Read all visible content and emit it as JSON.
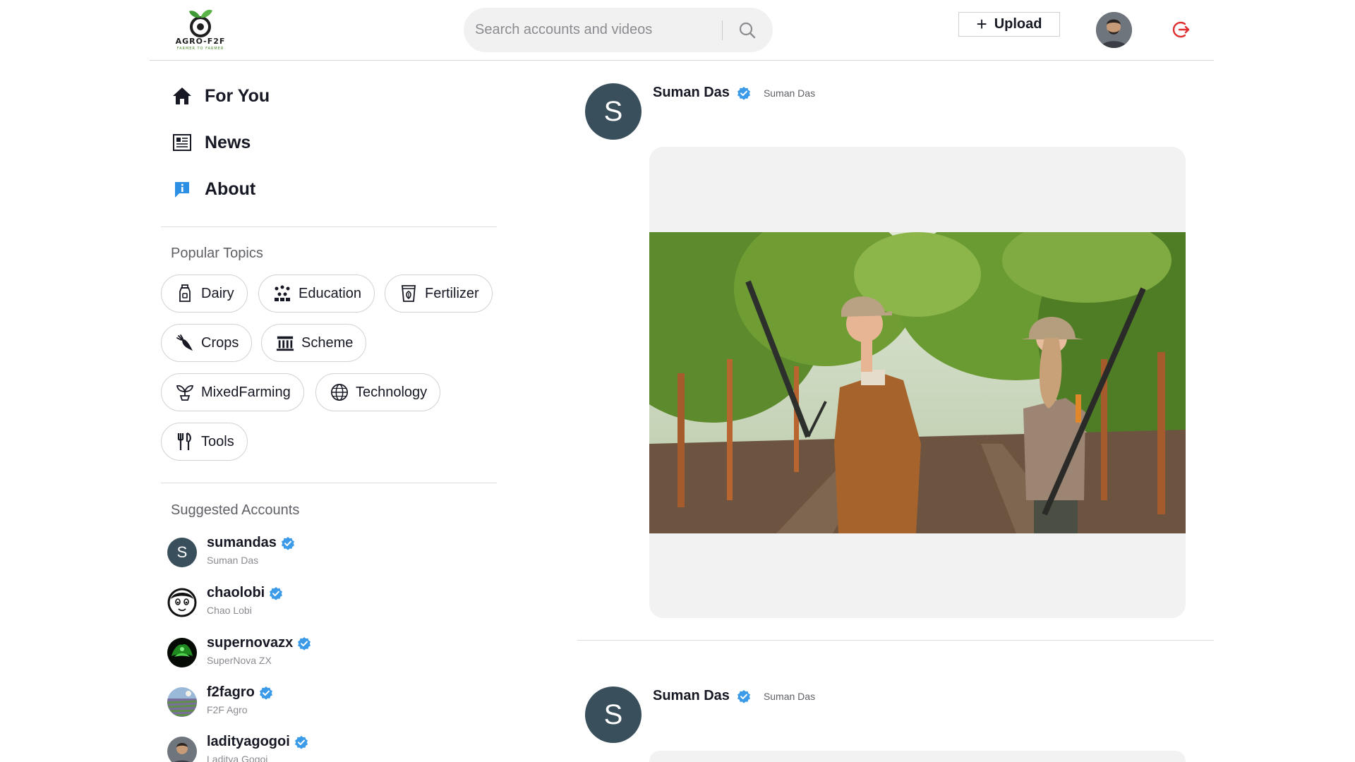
{
  "header": {
    "logo_title": "AGRO-F2F",
    "logo_subtitle": "FARMER TO FARMER",
    "search_placeholder": "Search accounts and videos",
    "upload_label": "Upload",
    "accent_color": "#e02d2d"
  },
  "nav": [
    {
      "label": "For You",
      "icon": "home-icon"
    },
    {
      "label": "News",
      "icon": "newspaper-icon"
    },
    {
      "label": "About",
      "icon": "info-icon"
    }
  ],
  "topics": {
    "title": "Popular Topics",
    "items": [
      {
        "label": "Dairy",
        "icon": "milk-bottle-icon"
      },
      {
        "label": "Education",
        "icon": "people-group-icon"
      },
      {
        "label": "Fertilizer",
        "icon": "fertilizer-icon"
      },
      {
        "label": "Crops",
        "icon": "carrot-icon"
      },
      {
        "label": "Scheme",
        "icon": "building-icon"
      },
      {
        "label": "MixedFarming",
        "icon": "sprout-icon"
      },
      {
        "label": "Technology",
        "icon": "globe-icon"
      },
      {
        "label": "Tools",
        "icon": "tools-icon"
      }
    ]
  },
  "suggested": {
    "title": "Suggested Accounts",
    "accounts": [
      {
        "username": "sumandas",
        "display": "Suman Das",
        "avatar": "S"
      },
      {
        "username": "chaolobi",
        "display": "Chao Lobi",
        "avatar": ""
      },
      {
        "username": "supernovazx",
        "display": "SuperNova ZX",
        "avatar": ""
      },
      {
        "username": "f2fagro",
        "display": "F2F Agro",
        "avatar": ""
      },
      {
        "username": "ladityagogoi",
        "display": "Laditya Gogoi",
        "avatar": ""
      }
    ]
  },
  "feed": {
    "posts": [
      {
        "author": "Suman Das",
        "handle": "Suman Das",
        "avatar": "S"
      },
      {
        "author": "Suman Das",
        "handle": "Suman Das",
        "avatar": "S"
      }
    ]
  },
  "colors": {
    "verified": "#3c9be8",
    "avatar_bg": "#3a4f5c",
    "logout": "#e02d2d"
  }
}
